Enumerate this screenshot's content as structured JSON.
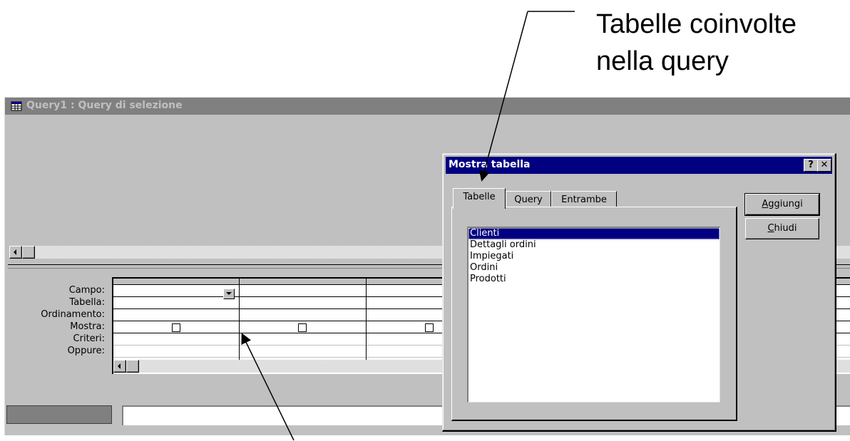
{
  "callout": {
    "line1": "Tabelle coinvolte",
    "line2": "nella query"
  },
  "query_window": {
    "title": "Query1 : Query di selezione",
    "grid_row_labels": [
      "Campo:",
      "Tabella:",
      "Ordinamento:",
      "Mostra:",
      "Criteri:",
      "Oppure:"
    ]
  },
  "dialog": {
    "title": "Mostra tabella",
    "help_button": "?",
    "close_button": "✕",
    "tabs": [
      "Tabelle",
      "Query",
      "Entrambe"
    ],
    "active_tab": "Tabelle",
    "tables": [
      "Clienti",
      "Dettagli ordini",
      "Impiegati",
      "Ordini",
      "Prodotti"
    ],
    "selected_table": "Clienti",
    "add_button": {
      "mnemonic": "A",
      "rest": "ggiungi"
    },
    "close_btn": {
      "mnemonic": "C",
      "rest": "hiudi"
    }
  },
  "colors": {
    "title_active": "#000080",
    "title_inactive": "#808080",
    "face": "#c0c0c0"
  }
}
